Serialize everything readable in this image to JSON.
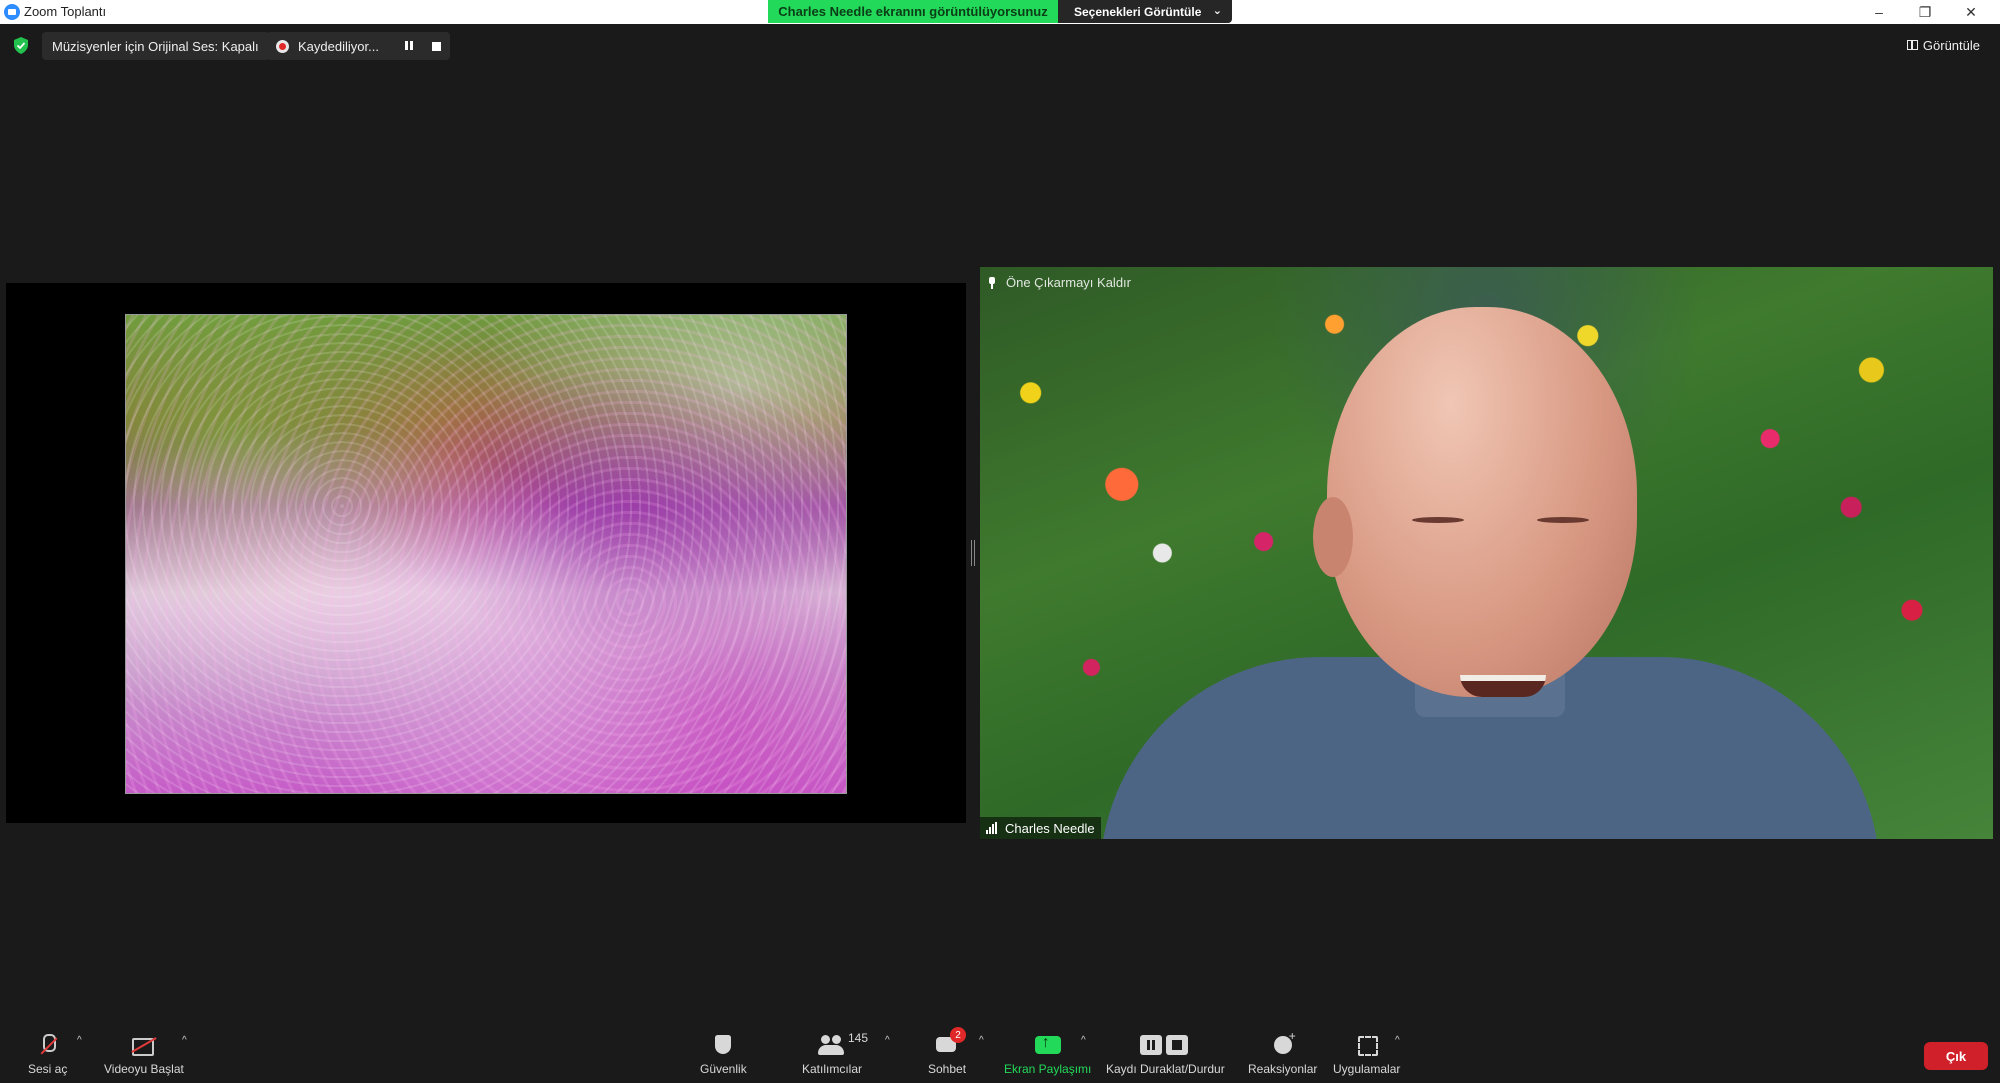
{
  "window": {
    "title": "Zoom Toplantı",
    "minimize": "–",
    "restore": "❐",
    "close": "✕"
  },
  "share_banner": {
    "text": "Charles Needle ekranını görüntülüyorsunuz",
    "options_label": "Seçenekleri Görüntüle",
    "options_chevron": "⌄"
  },
  "meeting_bar": {
    "original_sound": "Müzisyenler için Orijinal Ses: Kapalı",
    "recording_label": "Kaydediliyor...",
    "view_label": "Görüntüle"
  },
  "video": {
    "unpin_label": "Öne Çıkarmayı Kaldır",
    "participant_name": "Charles Needle"
  },
  "toolbar": {
    "unmute": "Sesi aç",
    "start_video": "Videoyu Başlat",
    "security": "Güvenlik",
    "participants": "Katılımcılar",
    "participants_count": "145",
    "chat": "Sohbet",
    "chat_badge": "2",
    "share_screen": "Ekran Paylaşımı",
    "record_controls": "Kaydı Duraklat/Durdur",
    "reactions": "Reaksiyonlar",
    "apps": "Uygulamalar",
    "caret": "^",
    "leave": "Çık"
  },
  "colors": {
    "accent_green": "#23d959",
    "leave_red": "#d0202a",
    "background": "#1a1a1a"
  },
  "icons": [
    "app-logo-icon",
    "shield-icon",
    "record-icon",
    "pause-icon",
    "stop-icon",
    "grid-view-icon",
    "pin-icon",
    "signal-icon",
    "mic-muted-icon",
    "camera-off-icon",
    "security-shield-icon",
    "participants-icon",
    "chat-icon",
    "share-screen-icon",
    "reactions-icon",
    "apps-icon"
  ]
}
